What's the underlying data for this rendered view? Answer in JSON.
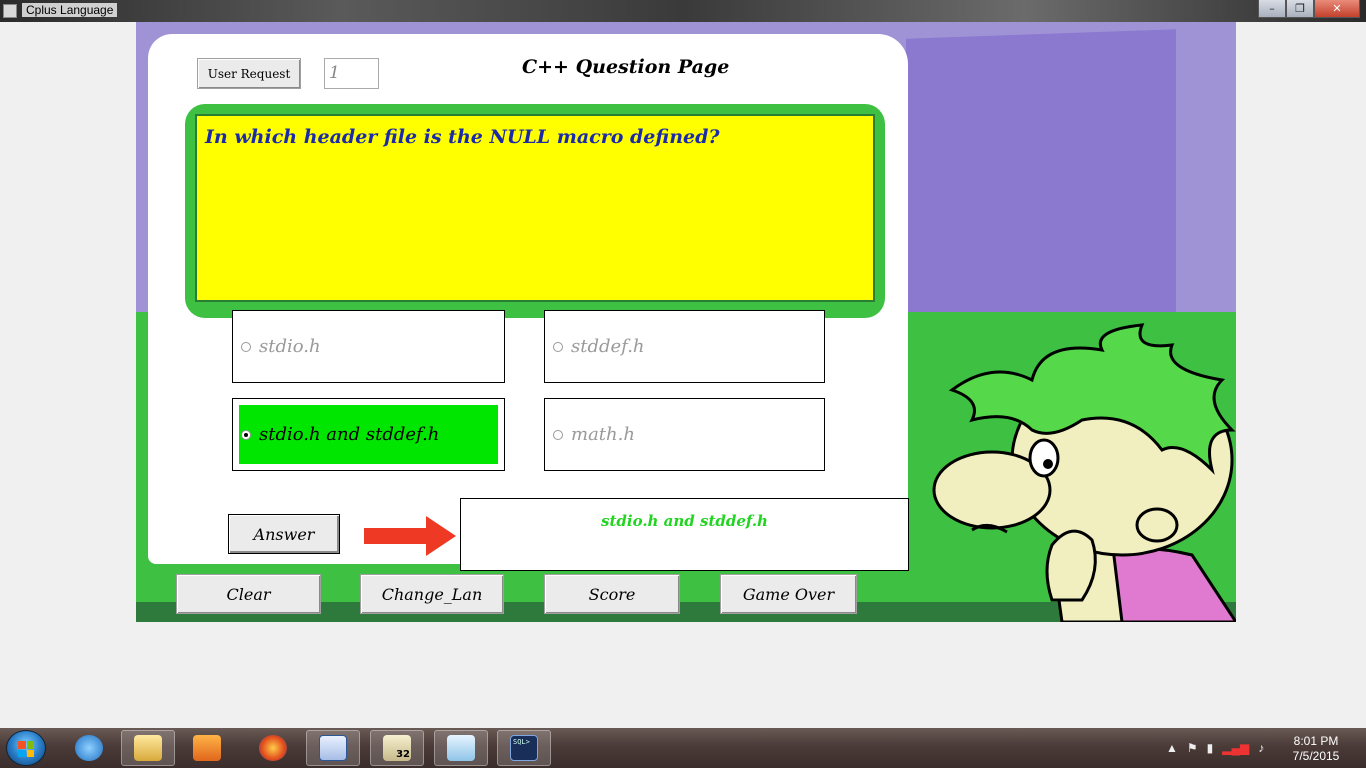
{
  "window": {
    "title": "Cplus Language",
    "controls": {
      "minimize": "–",
      "maximize": "❐",
      "close": "✕"
    }
  },
  "header": {
    "user_request_label": "User Request",
    "question_number": "1",
    "page_title": "C++ Question Page"
  },
  "question": {
    "text": "In which header file is the NULL macro defined?"
  },
  "options": [
    {
      "label": "stdio.h",
      "selected": false
    },
    {
      "label": "stddef.h",
      "selected": false
    },
    {
      "label": "stdio.h and stddef.h",
      "selected": true
    },
    {
      "label": "math.h",
      "selected": false
    }
  ],
  "answer": {
    "button_label": "Answer",
    "result_text": "stdio.h and stddef.h"
  },
  "bottom_buttons": {
    "clear": "Clear",
    "change_lan": "Change_Lan",
    "score": "Score",
    "game_over": "Game Over"
  },
  "colors": {
    "question_bg": "#ffff00",
    "question_frame": "#3ec043",
    "question_text": "#1a2aa8",
    "selected_option": "#00e600",
    "answer_text": "#22d422",
    "arrow": "#ee3a24",
    "sky": "#9f93d6",
    "grass": "#3ec043"
  },
  "taskbar": {
    "items": [
      "internet-explorer-icon",
      "file-explorer-icon",
      "media-player-icon",
      "firefox-icon",
      "word-icon",
      "app-32-icon",
      "notepad-icon",
      "sql-icon"
    ],
    "sql_label": "SQL>",
    "app_badge": "32",
    "time": "8:01 PM",
    "date": "7/5/2015"
  }
}
